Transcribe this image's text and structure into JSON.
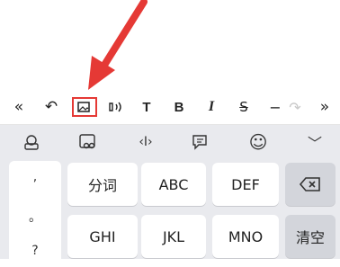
{
  "format_toolbar": {
    "items": [
      {
        "name": "collapse-toolbar-icon",
        "glyph": "«"
      },
      {
        "name": "undo-icon",
        "glyph": "↶"
      },
      {
        "name": "insert-image-icon",
        "glyph": ""
      },
      {
        "name": "voice-read-icon",
        "glyph": ""
      },
      {
        "name": "text-style-icon",
        "glyph": "T"
      },
      {
        "name": "bold-icon",
        "glyph": "B"
      },
      {
        "name": "italic-icon",
        "glyph": "I"
      },
      {
        "name": "strikethrough-icon",
        "glyph": "S"
      },
      {
        "name": "horizontal-line-icon",
        "glyph": "−"
      },
      {
        "name": "redo-icon",
        "glyph": "↷"
      },
      {
        "name": "expand-toolbar-icon",
        "glyph": "»"
      }
    ]
  },
  "keyboard": {
    "toolbar": [
      {
        "name": "keyboard-skin-icon"
      },
      {
        "name": "handwriting-icon"
      },
      {
        "name": "cursor-move-icon",
        "glyph": "‹I›"
      },
      {
        "name": "clipboard-icon"
      },
      {
        "name": "emoji-icon",
        "glyph": "☺"
      },
      {
        "name": "collapse-keyboard-icon",
        "glyph": "﹀"
      }
    ],
    "punctuation": [
      ",",
      "。",
      "?"
    ],
    "row1": {
      "k1": "分词",
      "k2": "ABC",
      "k3": "DEF"
    },
    "row2": {
      "k1": "GHI",
      "k2": "JKL",
      "k3": "MNO",
      "clear": "清空"
    }
  },
  "colors": {
    "accent": "#e53935",
    "keyboard_bg": "#e9eaee",
    "func_key": "#d3d5db"
  }
}
